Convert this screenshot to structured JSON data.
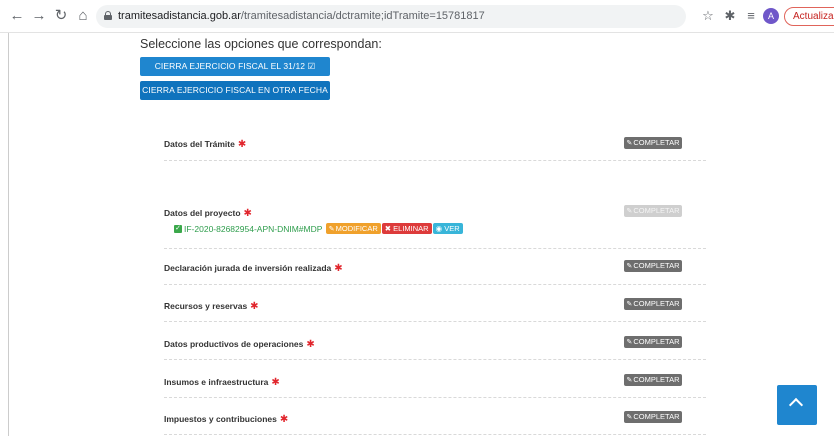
{
  "browser": {
    "url_host": "tramitesadistancia.gob.ar",
    "url_path": "/tramitesadistancia/dctramite;idTramite=15781817",
    "avatar_letter": "A",
    "update_label": "Actualizar"
  },
  "options": {
    "label": "Seleccione las opciones que correspondan:",
    "button1": "CIERRA EJERCICIO FISCAL EL 31/12 ☑",
    "button2": "CIERRA EJERCICIO FISCAL EN OTRA FECHA"
  },
  "sections": [
    {
      "title": "Datos del Trámite",
      "action": "COMPLETAR"
    },
    {
      "title": "Datos del proyecto",
      "action": "COMPLETAR"
    },
    {
      "title": "Declaración jurada de inversión realizada",
      "action": "COMPLETAR"
    },
    {
      "title": "Recursos y reservas",
      "action": "COMPLETAR"
    },
    {
      "title": "Datos productivos de operaciones",
      "action": "COMPLETAR"
    },
    {
      "title": "Insumos e infraestructura",
      "action": "COMPLETAR"
    },
    {
      "title": "Impuestos y contribuciones",
      "action": "COMPLETAR"
    }
  ],
  "document": {
    "id": "IF-2020-82682954-APN-DNIM#MDP",
    "modify": "MODIFICAR",
    "delete": "ELIMINAR",
    "view": "VER"
  },
  "required_mark": "✱",
  "colors": {
    "primary": "#1f86cf",
    "required": "#e1262d",
    "completar": "#6e6e6e",
    "modify": "#f0a12c",
    "delete": "#dd3b3b",
    "view": "#38b5d9"
  }
}
